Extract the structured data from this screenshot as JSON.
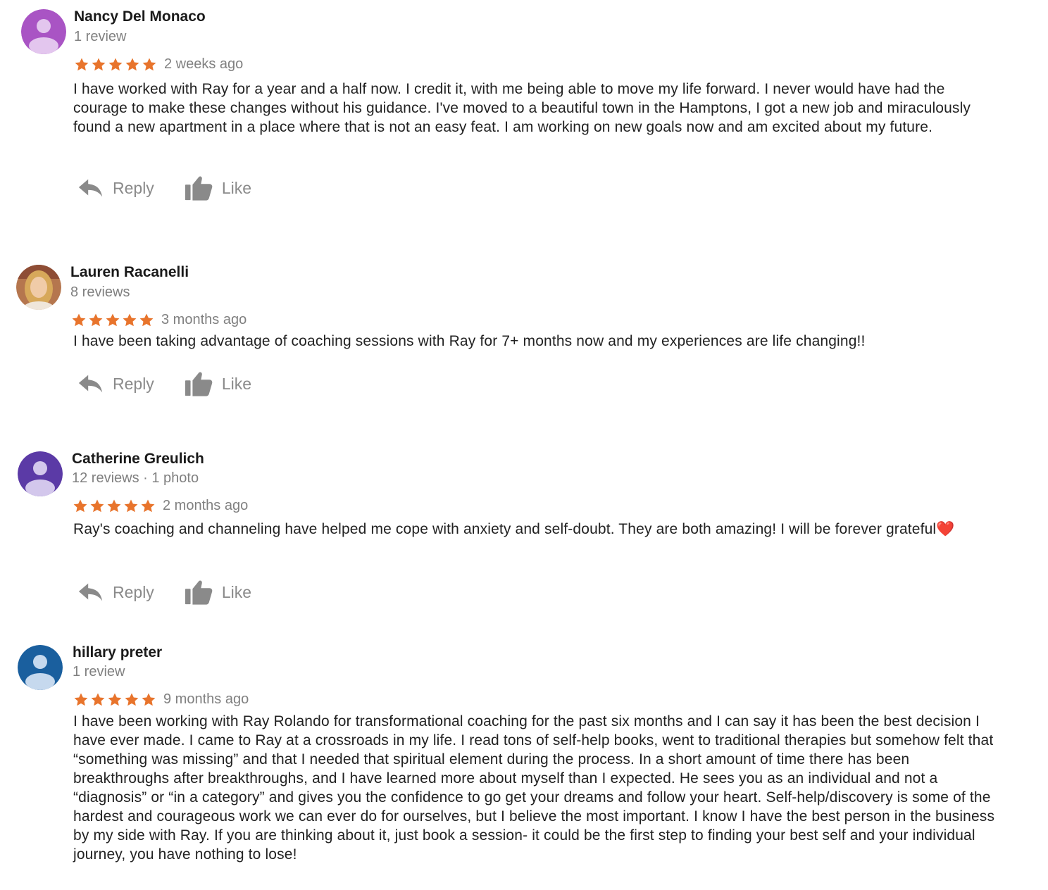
{
  "colors": {
    "star": "#e8742c",
    "muted_text": "#808080",
    "action_gray": "#8a8a8a",
    "avatar_nancy": "#a954c4",
    "avatar_catherine": "#5b3aa6",
    "avatar_hillary": "#1a5f9e"
  },
  "reviews": [
    {
      "author": "Nancy Del Monaco",
      "meta": "1 review",
      "rating": 5,
      "time": "2 weeks ago",
      "text": "I have worked with Ray for a year and a half now. I credit it, with me being able to move my life forward. I never would have had the courage to make these changes without his guidance. I've moved to a beautiful town in the Hamptons, I got a new job and miraculously found a new apartment in a place where that is not an easy feat. I am working on new goals now and am excited about my future.",
      "reply_label": "Reply",
      "like_label": "Like"
    },
    {
      "author": "Lauren Racanelli",
      "meta": "8 reviews",
      "rating": 5,
      "time": "3 months ago",
      "text": "I have been taking advantage of coaching sessions with Ray for 7+ months now and my experiences are life changing!!",
      "reply_label": "Reply",
      "like_label": "Like"
    },
    {
      "author": "Catherine Greulich",
      "meta": "12 reviews · 1 photo",
      "rating": 5,
      "time": "2 months ago",
      "text": "Ray's coaching and channeling have helped me cope with anxiety and self-doubt. They are both amazing! I will be forever grateful❤️",
      "reply_label": "Reply",
      "like_label": "Like"
    },
    {
      "author": "hillary preter",
      "meta": "1 review",
      "rating": 5,
      "time": "9 months ago",
      "text": "I have been working with Ray Rolando for transformational coaching for the past six months and I can say it has been the best decision I have ever made. I came to Ray at a crossroads in my life. I read tons of self-help books, went to traditional therapies but somehow felt that “something was missing” and that I needed that spiritual element during the process. In a short amount of time there has been breakthroughs after breakthroughs, and I have learned more about myself than I expected. He sees you as an individual and not a “diagnosis” or “in a category” and gives you the confidence to go get your dreams and follow your heart. Self-help/discovery is some of the hardest and courageous work we can ever do for ourselves, but I believe the most important. I know I have the best person in the business by my side with Ray. If you are thinking about it, just book a session- it could be the first step to finding your best self and your individual journey, you have nothing to lose!",
      "reply_label": "",
      "like_label": ""
    }
  ]
}
